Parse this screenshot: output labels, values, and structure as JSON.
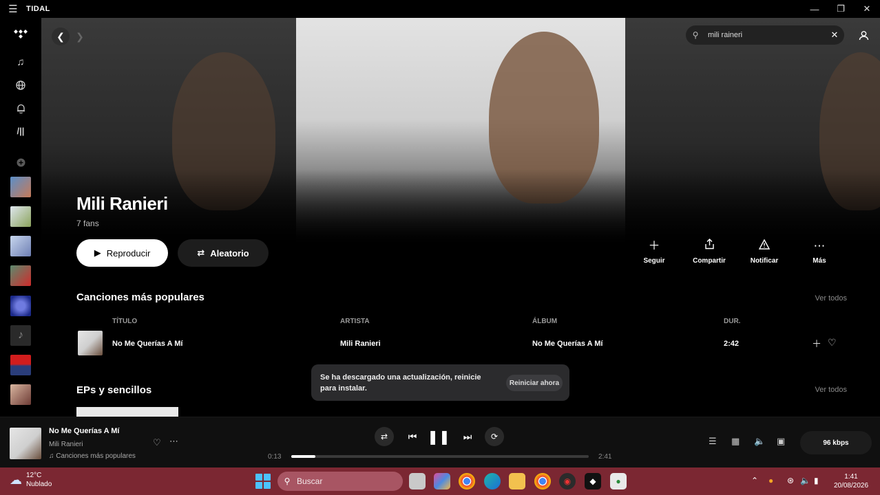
{
  "window": {
    "app_name": "TIDAL",
    "menu_icon": "hamburger-icon",
    "controls": [
      "minimize",
      "maximize",
      "close"
    ]
  },
  "search": {
    "value": "mili raineri",
    "icon": "search-icon"
  },
  "artist": {
    "name": "Mili Ranieri",
    "fans": "7 fans"
  },
  "buttons": {
    "play": "Reproducir",
    "shuffle": "Aleatorio"
  },
  "actions": [
    {
      "label": "Seguir",
      "icon": "plus-icon"
    },
    {
      "label": "Compartir",
      "icon": "share-icon"
    },
    {
      "label": "Notificar",
      "icon": "alert-icon"
    },
    {
      "label": "Más",
      "icon": "more-icon"
    }
  ],
  "popular": {
    "title": "Canciones más populares",
    "see_all": "Ver todos",
    "columns": {
      "title": "TÍTULO",
      "artist": "ARTISTA",
      "album": "ÁLBUM",
      "duration": "DUR."
    },
    "tracks": [
      {
        "title": "No Me Querías A Mí",
        "artist": "Mili Ranieri",
        "album": "No Me Querías A Mí",
        "duration": "2:42"
      }
    ]
  },
  "eps": {
    "title": "EPs y sencillos",
    "see_all": "Ver todos"
  },
  "toast": {
    "message": "Se ha descargado una actualización, reinicie para instalar.",
    "button": "Reiniciar ahora"
  },
  "player": {
    "title": "No Me Querías A Mí",
    "artist": "Mili Ranieri",
    "source": "Canciones más populares",
    "elapsed": "0:13",
    "total": "2:41",
    "progress": 0.08,
    "quality": "96 kbps"
  },
  "taskbar": {
    "weather_temp": "12°C",
    "weather_desc": "Nublado",
    "search_placeholder": "Buscar",
    "time": "1:41",
    "date": "20/08/2026"
  },
  "colors": {
    "background": "#000000",
    "taskbar": "#7b2732",
    "accent_white": "#ffffff"
  }
}
